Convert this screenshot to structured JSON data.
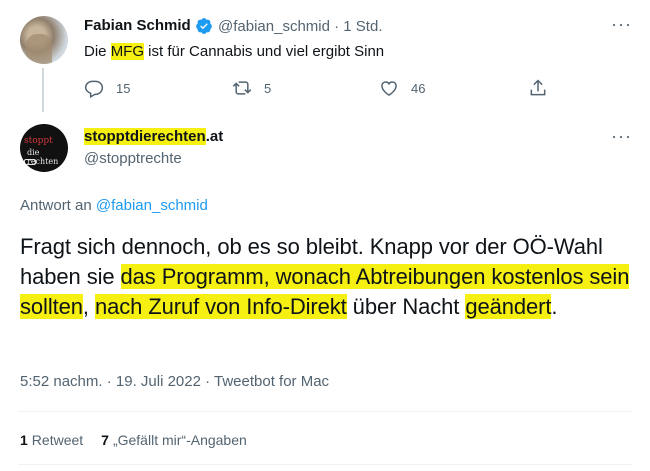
{
  "parent_tweet": {
    "author_name": "Fabian Schmid",
    "author_handle": "@fabian_schmid",
    "separator": "·",
    "time_ago": "1 Std.",
    "more_label": "···",
    "text_before": "Die ",
    "text_highlight": "MFG",
    "text_after": " ist für Cannabis und viel ergibt Sinn",
    "reply_count": "15",
    "retweet_count": "5",
    "like_count": "46"
  },
  "main_tweet": {
    "author_name_highlight": "stopptdierechten",
    "author_name_tail": ".at",
    "author_handle": "@stopptrechte",
    "avatar_text_line1": "stoppt",
    "avatar_text_line2": "die rechten",
    "more_label": "···",
    "reply_prefix": "Antwort an ",
    "reply_to_handle": "@fabian_schmid",
    "body_segments": [
      "Fragt sich dennoch, ob es so bleibt. Knapp vor der OÖ-Wahl haben sie ",
      "das Programm, wonach Abtreibungen kostenlos sein sollten",
      ", ",
      "nach Zuruf von Info-Direkt",
      " über Nacht ",
      "geändert",
      "."
    ],
    "timestamp": "5:52 nachm. · 19. Juli 2022 · Tweetbot for Mac",
    "retweets_count": "1",
    "retweets_label": "Retweet",
    "likes_count": "7",
    "likes_label": "„Gefällt mir“-Angaben"
  },
  "colors": {
    "highlight": "#f5f012",
    "link": "#1d9bf0",
    "muted": "#536471",
    "verified": "#1d9bf0"
  },
  "icons": [
    "verified-badge-icon",
    "more-icon",
    "reply-icon",
    "retweet-icon",
    "like-icon",
    "share-icon"
  ]
}
